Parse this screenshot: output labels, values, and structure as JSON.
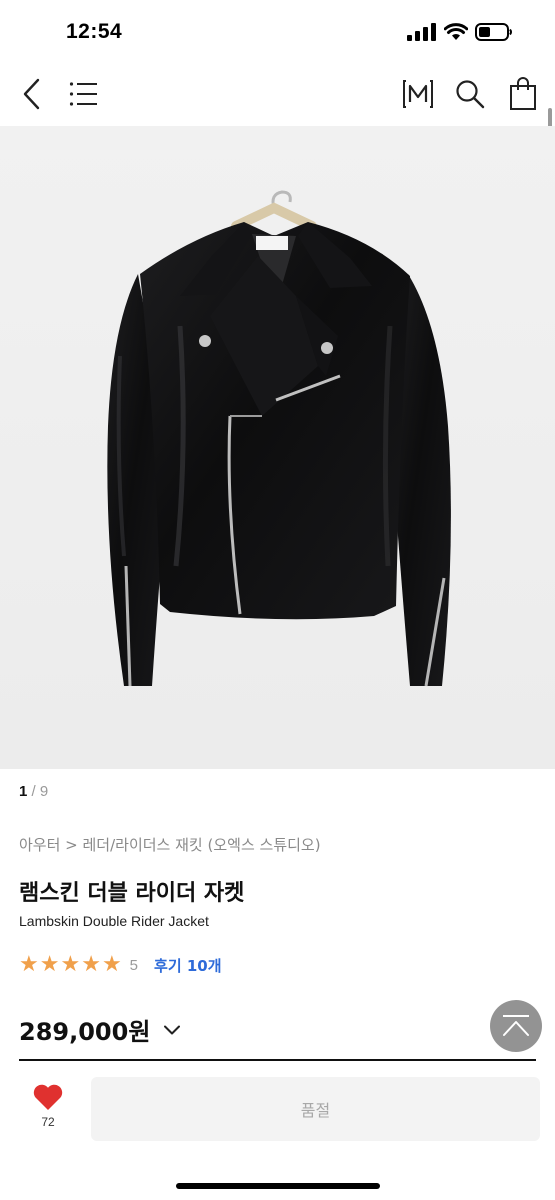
{
  "status_bar": {
    "time": "12:54",
    "icons": [
      "signal-icon",
      "wifi-icon",
      "battery-icon"
    ]
  },
  "nav": {
    "back_icon": "chevron-left-icon",
    "menu_icon": "hamburger-menu-icon",
    "m_badge_label": "M",
    "search_icon": "search-icon",
    "cart_icon": "shopping-bag-icon"
  },
  "gallery": {
    "current": "1",
    "separator": " / ",
    "total": "9",
    "image": "black-leather-double-rider-jacket-on-hanger"
  },
  "product": {
    "breadcrumb": "아우터 > 레더/라이더스 재킷 (오엑스 스튜디오)",
    "name_ko": "램스킨 더블 라이더 자켓",
    "name_en": "Lambskin Double Rider Jacket",
    "rating_stars": 5,
    "rating_score": "5",
    "review_link": "후기 10개",
    "price": "289,000원"
  },
  "bottom_bar": {
    "like_count": "72",
    "soldout_label": "품절"
  },
  "colors": {
    "star": "#f0a04b",
    "review_link": "#2e6bd9",
    "like_heart": "#e0312f",
    "soldout_bg": "#f3f3f3",
    "soldout_text": "#a8a8a8"
  }
}
